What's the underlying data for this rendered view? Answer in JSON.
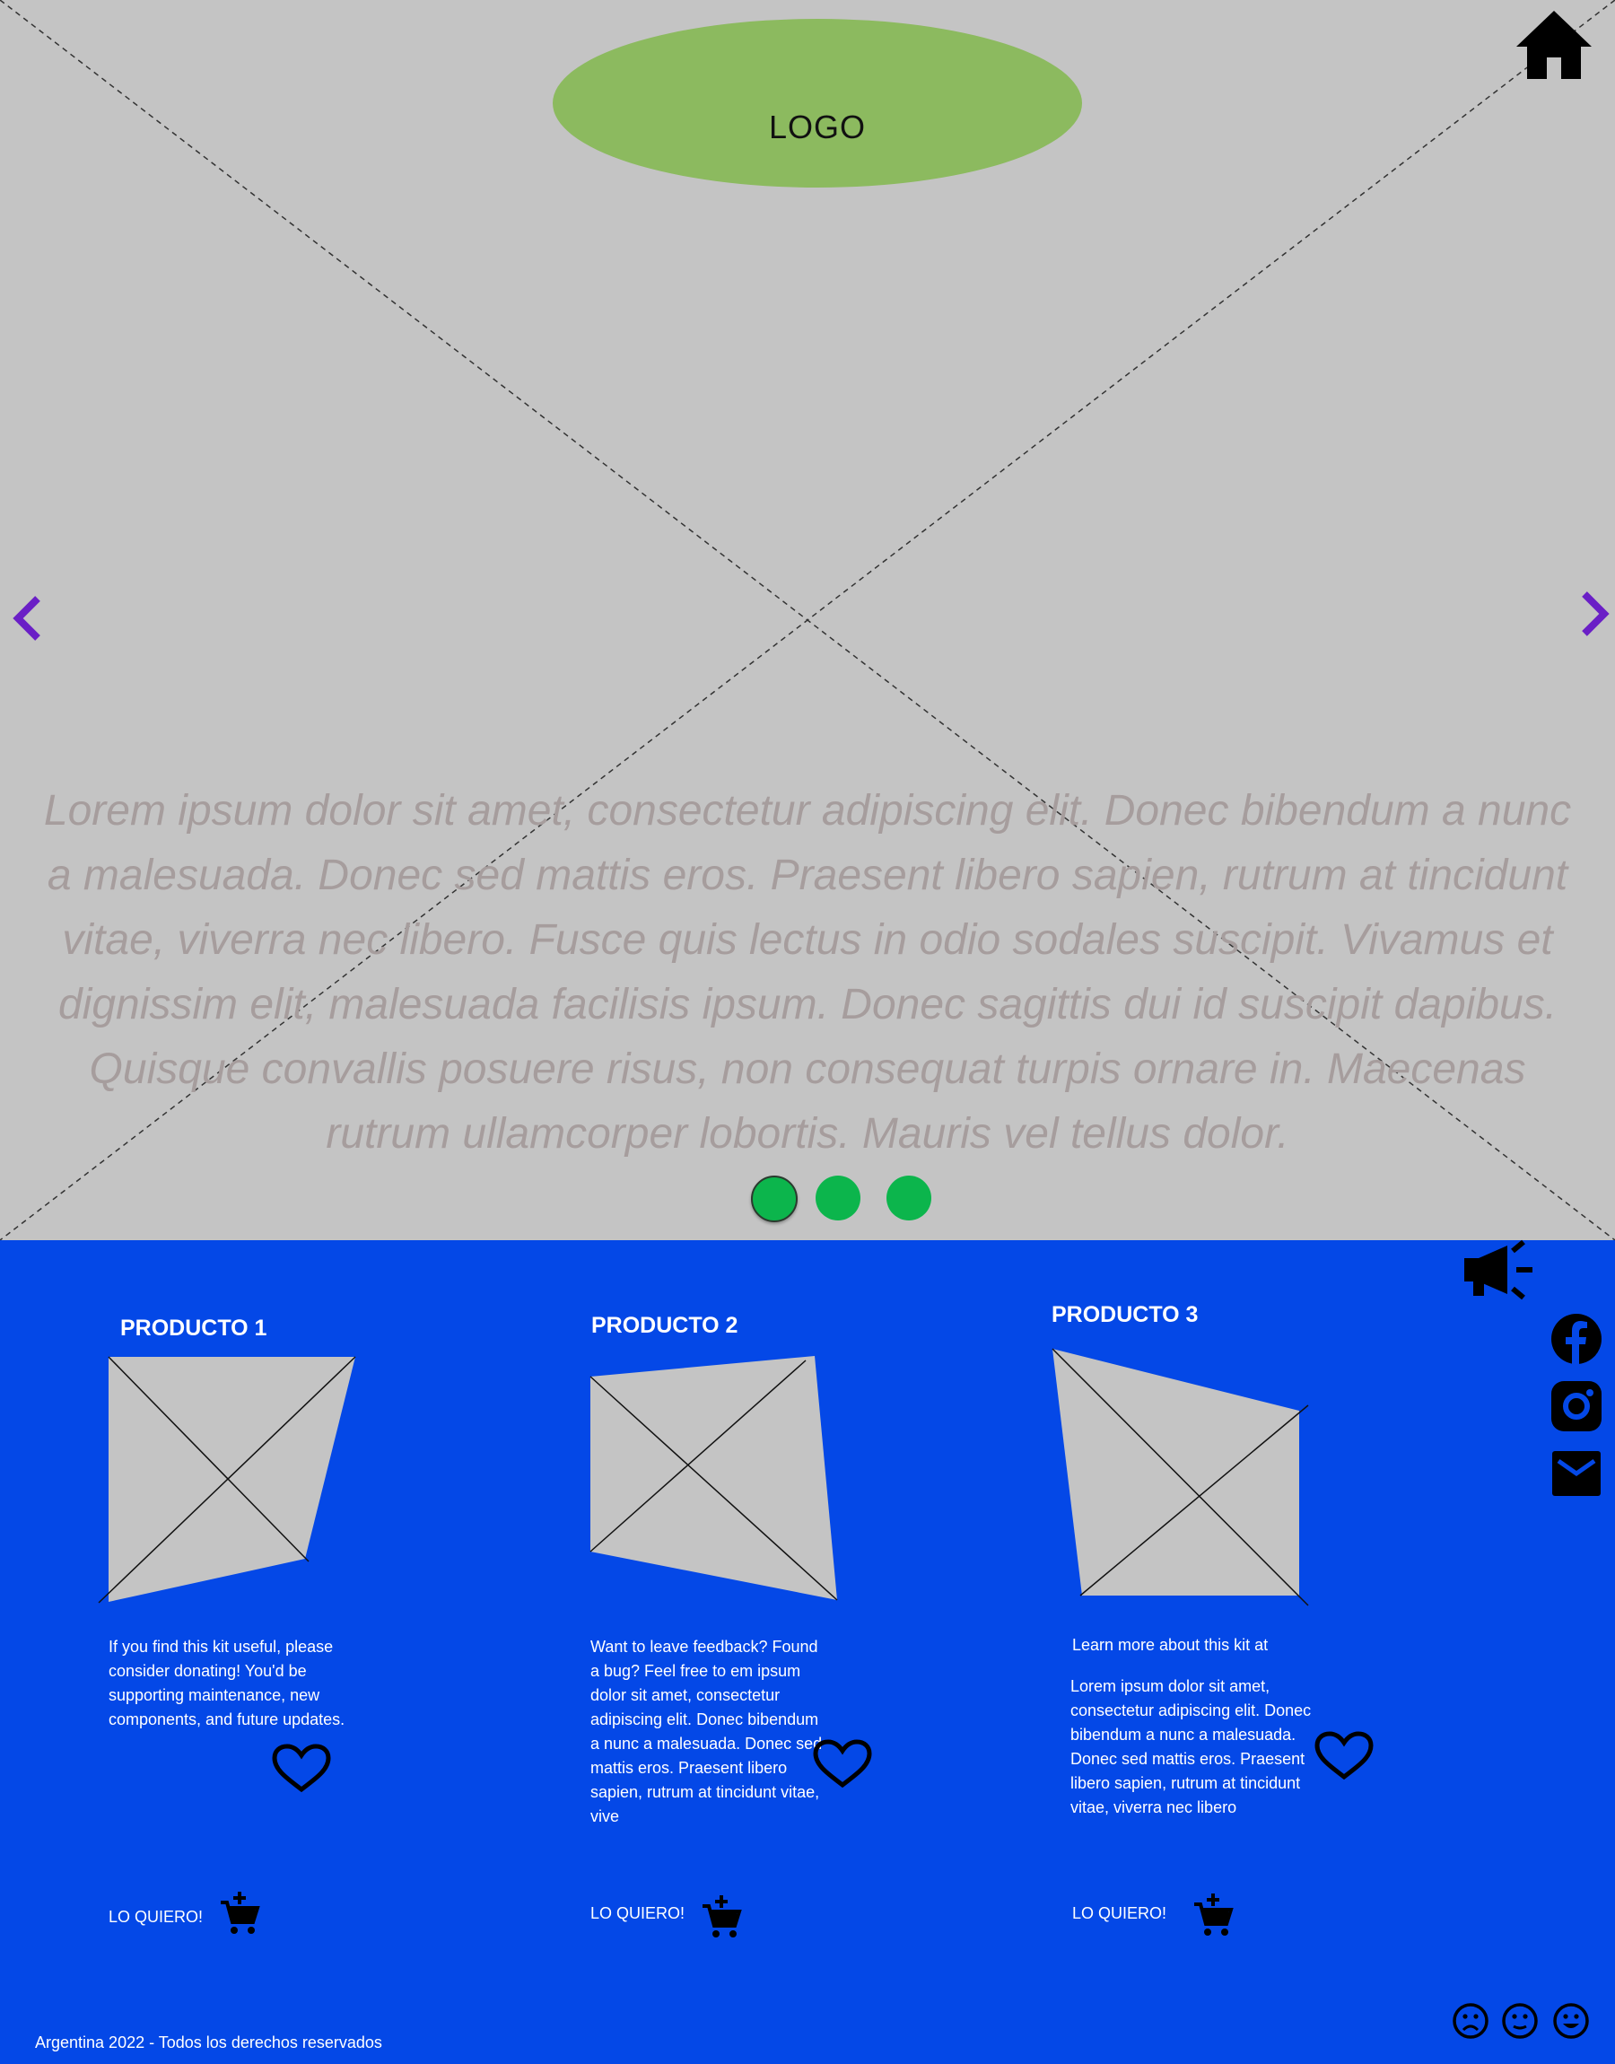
{
  "header": {
    "logo_text": "LOGO"
  },
  "hero": {
    "text": "Lorem ipsum dolor sit amet, consectetur adipiscing elit. Donec bibendum a nunc a malesuada. Donec sed mattis eros. Praesent libero sapien, rutrum at tincidunt vitae, viverra nec libero. Fusce quis lectus in odio sodales suscipit. Vivamus et dignissim elit, malesuada facilisis ipsum. Donec sagittis dui id suscipit dapibus. Quisque convallis posuere risus, non consequat turpis ornare in. Maecenas rutrum ullamcorper lobortis. Mauris vel tellus dolor.",
    "slides": 3,
    "active_slide": 1
  },
  "products": [
    {
      "title": "PRODUCTO 1",
      "description": "If you find this kit useful, please consider donating! You'd be supporting maintenance, new components, and future updates.",
      "buy_label": "LO QUIERO!"
    },
    {
      "title": "PRODUCTO 2",
      "description": "Want to leave feedback? Found a bug? Feel free to em ipsum dolor sit amet, consectetur adipiscing elit. Donec bibendum a nunc a malesuada. Donec sed mattis eros. Praesent libero sapien, rutrum at tincidunt vitae, vive",
      "buy_label": "LO QUIERO!"
    },
    {
      "title": "PRODUCTO 3",
      "subtitle": "Learn more about this kit at",
      "description": "Lorem ipsum dolor sit amet, consectetur adipiscing elit. Donec bibendum a nunc a malesuada. Donec sed mattis eros. Praesent libero sapien, rutrum at tincidunt vitae, viverra nec libero",
      "buy_label": "LO QUIERO!"
    }
  ],
  "footer": {
    "text": "Argentina 2022 - Todos los derechos reservados"
  },
  "colors": {
    "hero_bg": "#c4c4c4",
    "body_bg": "#0448e7",
    "logo": "#8cba5f",
    "dots": "#0cb54c",
    "arrows": "#6a1fc6",
    "placeholder": "#c4c4c4"
  },
  "icons": [
    "home-icon",
    "chevron-left-icon",
    "chevron-right-icon",
    "megaphone-icon",
    "facebook-icon",
    "instagram-icon",
    "mail-icon",
    "heart-icon",
    "cart-icon",
    "sad-face-icon",
    "neutral-face-icon",
    "happy-face-icon"
  ]
}
